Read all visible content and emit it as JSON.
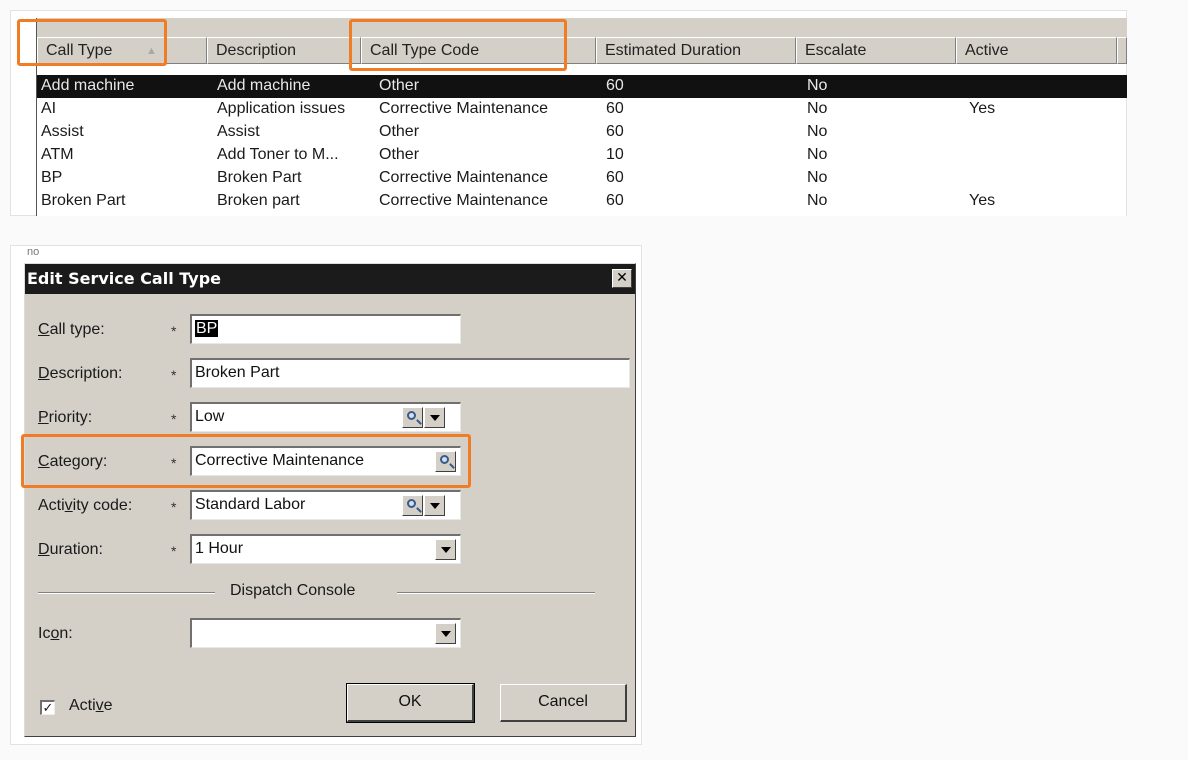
{
  "list": {
    "columns": [
      "Call Type",
      "Description",
      "Call Type Code",
      "Estimated Duration",
      "Escalate",
      "Active"
    ],
    "sort_indicator": "▲",
    "rows": [
      {
        "call_type": "Add machine",
        "description": "Add machine",
        "code": "Other",
        "duration": "60",
        "escalate": "No",
        "active": ""
      },
      {
        "call_type": "AI",
        "description": "Application issues",
        "code": "Corrective Maintenance",
        "duration": "60",
        "escalate": "No",
        "active": "Yes"
      },
      {
        "call_type": "Assist",
        "description": "Assist",
        "code": "Other",
        "duration": "60",
        "escalate": "No",
        "active": ""
      },
      {
        "call_type": "ATM",
        "description": "Add Toner to M...",
        "code": "Other",
        "duration": "10",
        "escalate": "No",
        "active": ""
      },
      {
        "call_type": "BP",
        "description": "Broken Part",
        "code": "Corrective Maintenance",
        "duration": "60",
        "escalate": "No",
        "active": ""
      },
      {
        "call_type": "Broken Part",
        "description": "Broken part",
        "code": "Corrective Maintenance",
        "duration": "60",
        "escalate": "No",
        "active": "Yes"
      }
    ],
    "selected_row": 0
  },
  "dialog": {
    "peek_text": "no",
    "title": "Edit Service Call Type",
    "close_glyph": "✕",
    "required_mark": "*",
    "fields": {
      "call_type": {
        "label_u": "C",
        "label_rest": "all type:",
        "value": "BP"
      },
      "description": {
        "label_u": "D",
        "label_rest": "escription:",
        "value": "Broken Part"
      },
      "priority": {
        "label_u": "P",
        "label_rest": "riority:",
        "value": "Low"
      },
      "category": {
        "label_u": "C",
        "label_rest": "ategory:",
        "value": "Corrective Maintenance"
      },
      "activity_code": {
        "label_pre": "Acti",
        "label_u": "v",
        "label_rest": "ity code:",
        "value": "Standard Labor"
      },
      "duration": {
        "label_u": "D",
        "label_rest": "uration:",
        "value": "1 Hour"
      },
      "icon": {
        "label_pre": "Ic",
        "label_u": "o",
        "label_rest": "n:",
        "value": ""
      }
    },
    "group_label": "Dispatch Console",
    "ok_label": "OK",
    "cancel_label": "Cancel",
    "active_checkbox": {
      "checked": true,
      "check_glyph": "✓",
      "label_pre": "Acti",
      "label_u": "v",
      "label_rest": "e"
    }
  },
  "colors": {
    "callout": "#f07c26",
    "selection": "#111111",
    "dialog_face": "#d4d0c8"
  }
}
